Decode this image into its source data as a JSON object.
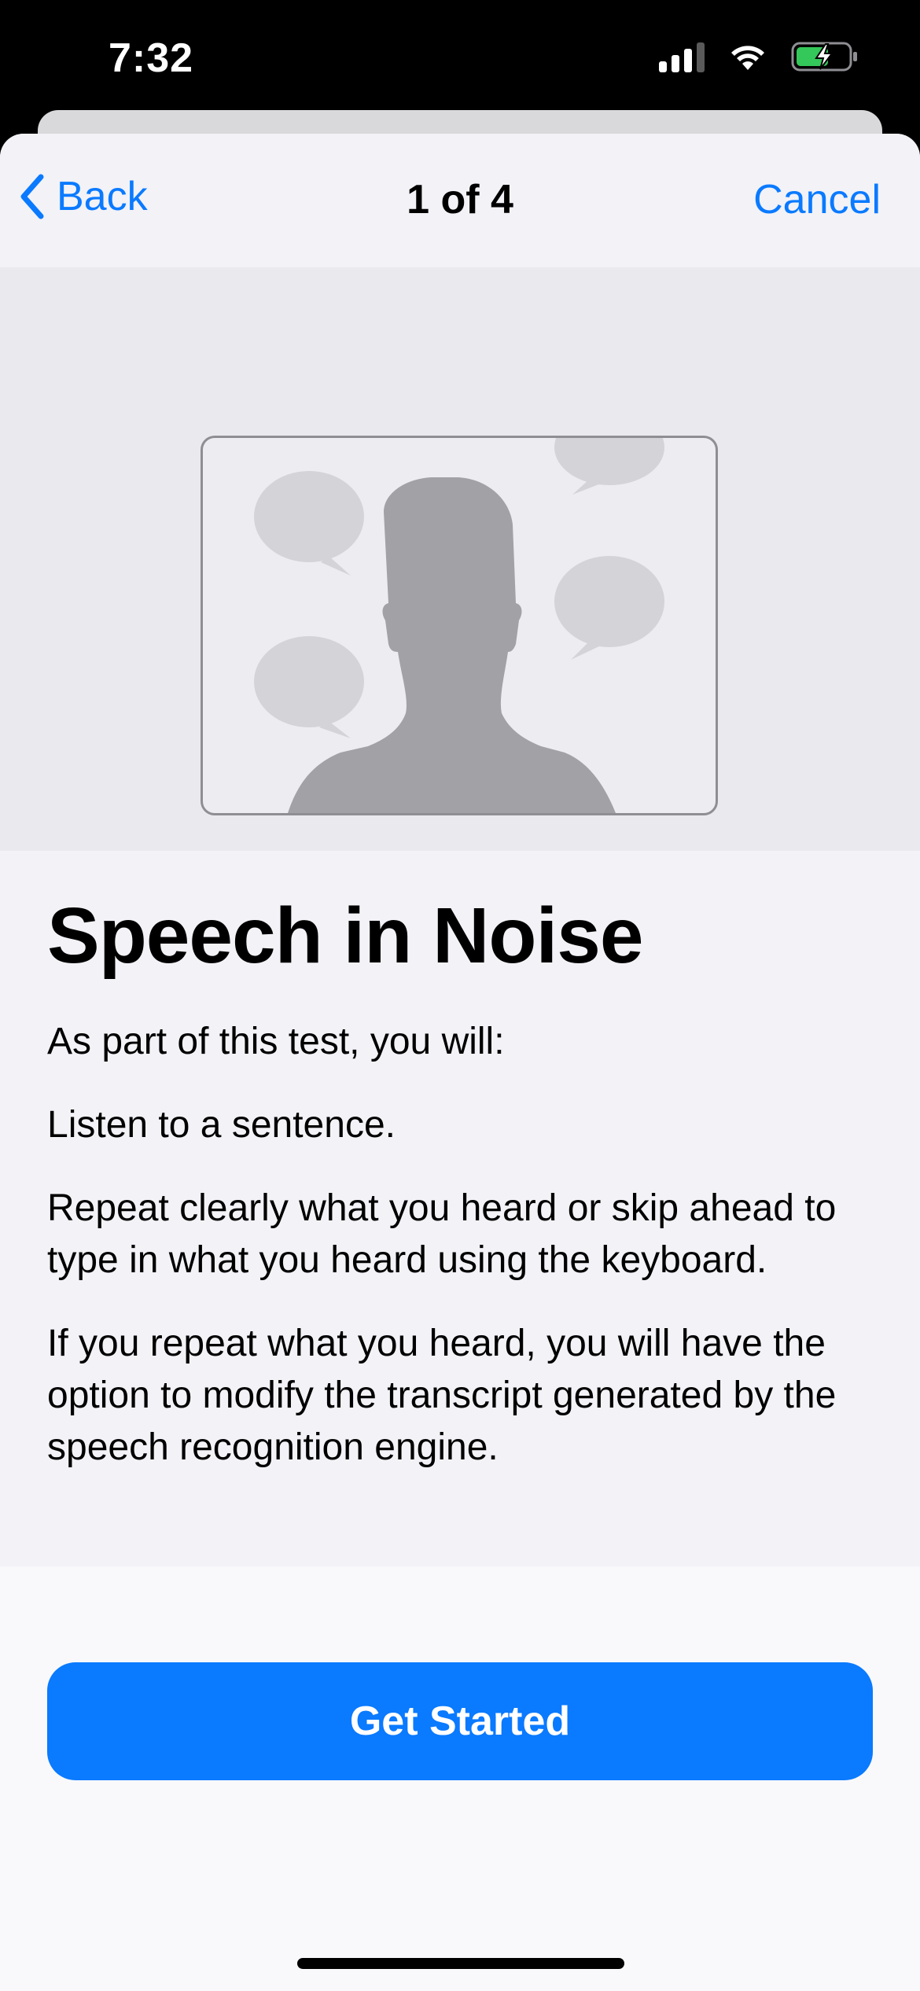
{
  "status_bar": {
    "time": "7:32",
    "icons": [
      "cellular-signal-icon",
      "wifi-icon",
      "battery-charging-icon"
    ]
  },
  "nav": {
    "back_label": "Back",
    "title": "1 of 4",
    "cancel_label": "Cancel"
  },
  "hero": {
    "illustration": "person-silhouette-with-speech-bubbles"
  },
  "content": {
    "title": "Speech in Noise",
    "paragraphs": [
      "As part of this test, you will:",
      "Listen to a sentence.",
      "Repeat clearly what you heard or skip ahead to type in what you heard using the keyboard.",
      "If you repeat what you heard, you will have the option to modify the transcript generated by the speech recognition engine."
    ]
  },
  "footer": {
    "primary_button_label": "Get Started"
  },
  "colors": {
    "accent": "#0a7aff",
    "background": "#f2f2f7",
    "hero_background": "#e9e9ee"
  }
}
